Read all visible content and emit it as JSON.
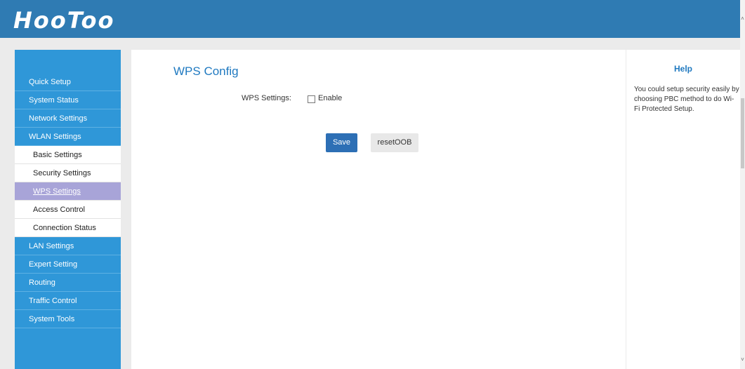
{
  "header": {
    "logo_text": "HooToo"
  },
  "sidebar": {
    "items": [
      {
        "label": "Quick Setup"
      },
      {
        "label": "System Status"
      },
      {
        "label": "Network Settings"
      },
      {
        "label": "WLAN Settings"
      },
      {
        "label": "Basic Settings"
      },
      {
        "label": "Security Settings"
      },
      {
        "label": "WPS Settings"
      },
      {
        "label": "Access Control"
      },
      {
        "label": "Connection Status"
      },
      {
        "label": "LAN Settings"
      },
      {
        "label": "Expert Setting"
      },
      {
        "label": "Routing"
      },
      {
        "label": "Traffic Control"
      },
      {
        "label": "System Tools"
      }
    ],
    "active_item": "WPS Settings"
  },
  "main": {
    "title": "WPS Config",
    "wps_settings_label": "WPS Settings:",
    "enable_label": "Enable",
    "enable_checked": false,
    "save_label": "Save",
    "reset_label": "resetOOB"
  },
  "help": {
    "title": "Help",
    "text": "You could setup security easily by choosing PBC method to do Wi-Fi Protected Setup."
  },
  "scroll": {
    "up_arrow": "˄",
    "down_arrow": "˅"
  },
  "colors": {
    "header": "#2f7bb3",
    "sidebar": "#2f97d8",
    "active_item": "#a8a4d8",
    "title": "#1f79c0",
    "save_button": "#2d6fb5"
  }
}
